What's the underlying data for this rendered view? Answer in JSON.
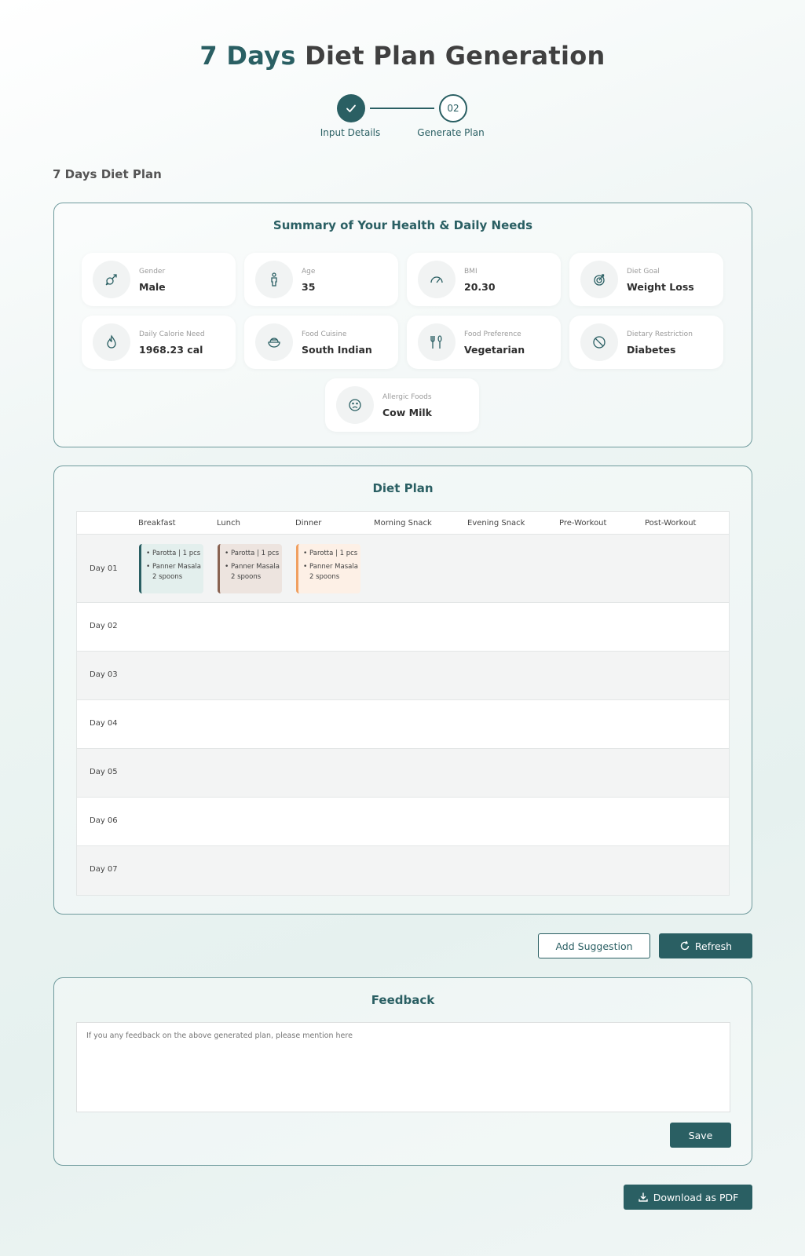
{
  "header": {
    "title_accent": "7 Days",
    "title_rest": " Diet Plan Generation"
  },
  "stepper": {
    "steps": [
      {
        "label": "Input Details",
        "state": "completed"
      },
      {
        "label": "Generate Plan",
        "number": "02",
        "state": "current"
      }
    ]
  },
  "section_heading": "7 Days Diet Plan",
  "summary": {
    "title": "Summary of Your Health & Daily Needs",
    "metrics": [
      {
        "label": "Gender",
        "value": "Male",
        "icon": "gender-icon"
      },
      {
        "label": "Age",
        "value": "35",
        "icon": "person-icon"
      },
      {
        "label": "BMI",
        "value": "20.30",
        "icon": "gauge-icon"
      },
      {
        "label": "Diet Goal",
        "value": "Weight Loss",
        "icon": "target-icon"
      },
      {
        "label": "Daily Calorie Need",
        "value": "1968.23 cal",
        "icon": "flame-icon"
      },
      {
        "label": "Food Cuisine",
        "value": "South Indian",
        "icon": "bowl-icon"
      },
      {
        "label": "Food Preference",
        "value": "Vegetarian",
        "icon": "utensils-icon"
      },
      {
        "label": "Dietary Restriction",
        "value": "Diabetes",
        "icon": "ban-icon"
      },
      {
        "label": "Allergic Foods",
        "value": "Cow Milk",
        "icon": "sad-face-icon"
      }
    ]
  },
  "diet_plan": {
    "title": "Diet Plan",
    "columns": [
      "Breakfast",
      "Lunch",
      "Dinner",
      "Morning Snack",
      "Evening Snack",
      "Pre-Workout",
      "Post-Workout"
    ],
    "days": [
      "Day 01",
      "Day 02",
      "Day 03",
      "Day 04",
      "Day 05",
      "Day 06",
      "Day 07"
    ],
    "day1_meals": {
      "breakfast": {
        "item1": "Parotta | 1 pcs",
        "item2": "Panner Masala 2 spoons",
        "color": "#2a5f63",
        "bg": "#e3efed"
      },
      "lunch": {
        "item1": "Parotta | 1 pcs",
        "item2": "Panner Masala 2 spoons",
        "color": "#8a6352",
        "bg": "#ede4df"
      },
      "dinner": {
        "item1": "Parotta | 1 pcs",
        "item2": "Panner Masala 2 spoons",
        "color": "#f0a061",
        "bg": "#fdf0e6"
      }
    }
  },
  "actions": {
    "add_suggestion": "Add Suggestion",
    "refresh": "Refresh"
  },
  "feedback": {
    "title": "Feedback",
    "placeholder": "If you any feedback on the above generated plan, please mention here",
    "save": "Save"
  },
  "download": "Download as PDF"
}
